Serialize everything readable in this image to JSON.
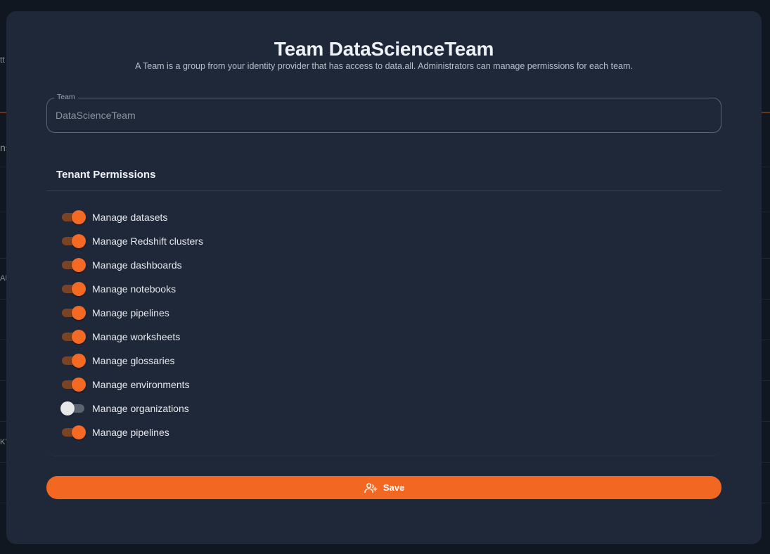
{
  "background": {
    "fragments": [
      "tt",
      "ns",
      "AB",
      "KY"
    ]
  },
  "modal": {
    "title": "Team DataScienceTeam",
    "subtitle": "A Team is a group from your identity provider that has access to data.all. Administrators can manage permissions for each team.",
    "team_field": {
      "label": "Team",
      "value": "DataScienceTeam"
    },
    "permissions": {
      "header": "Tenant Permissions",
      "items": [
        {
          "label": "Manage datasets",
          "enabled": true
        },
        {
          "label": "Manage Redshift clusters",
          "enabled": true
        },
        {
          "label": "Manage dashboards",
          "enabled": true
        },
        {
          "label": "Manage notebooks",
          "enabled": true
        },
        {
          "label": "Manage pipelines",
          "enabled": true
        },
        {
          "label": "Manage worksheets",
          "enabled": true
        },
        {
          "label": "Manage glossaries",
          "enabled": true
        },
        {
          "label": "Manage environments",
          "enabled": true
        },
        {
          "label": "Manage organizations",
          "enabled": false
        },
        {
          "label": "Manage pipelines",
          "enabled": true
        }
      ]
    },
    "save_button": {
      "label": "Save",
      "icon": "user-add-icon"
    }
  },
  "colors": {
    "accent": "#f26722",
    "modal_bg": "#1f2839",
    "toggle_on_track": "#7a4424",
    "toggle_off_thumb": "#e8e8e8"
  }
}
